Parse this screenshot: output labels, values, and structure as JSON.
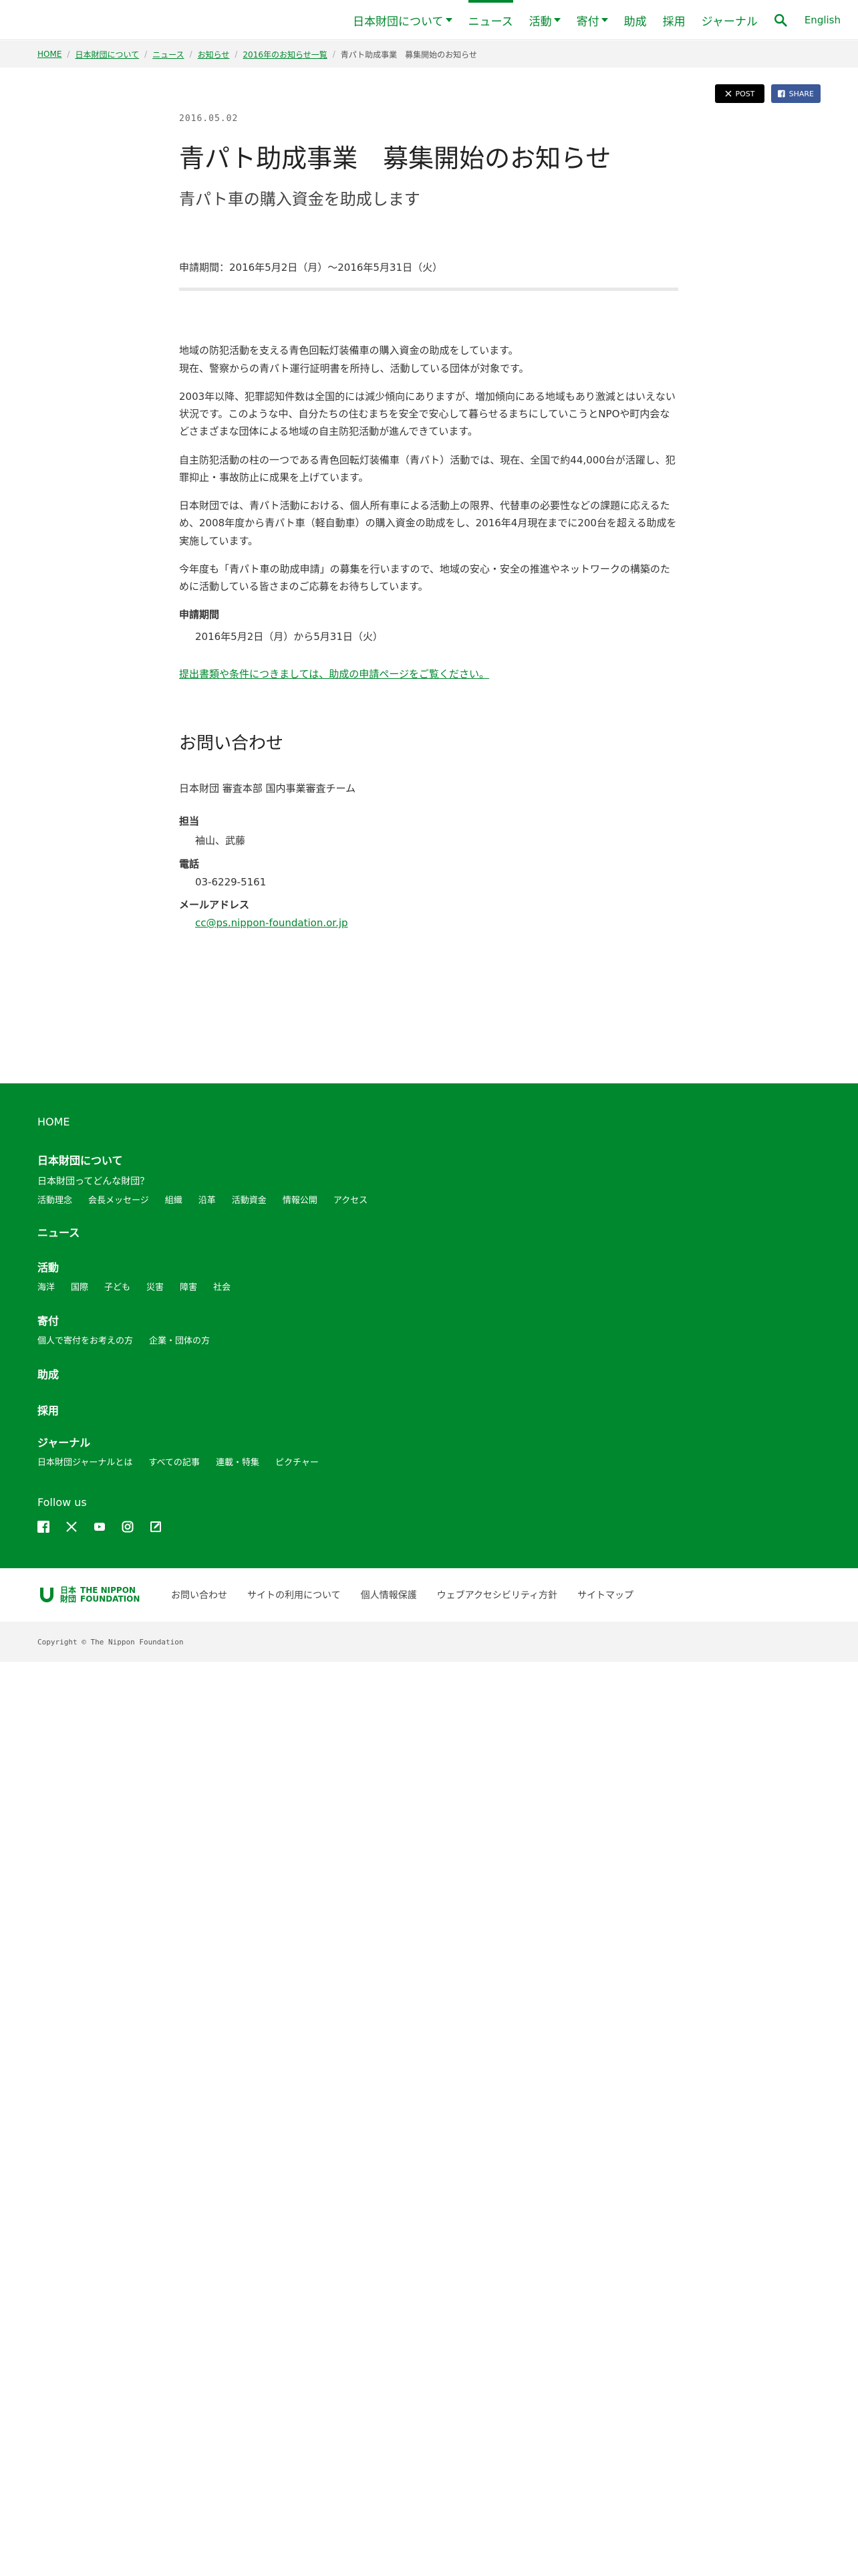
{
  "header": {
    "nav": [
      {
        "label": "日本財団について",
        "dropdown": true,
        "active": false
      },
      {
        "label": "ニュース",
        "dropdown": false,
        "active": true
      },
      {
        "label": "活動",
        "dropdown": true,
        "active": false
      },
      {
        "label": "寄付",
        "dropdown": true,
        "active": false
      },
      {
        "label": "助成",
        "dropdown": false,
        "active": false
      },
      {
        "label": "採用",
        "dropdown": false,
        "active": false
      },
      {
        "label": "ジャーナル",
        "dropdown": false,
        "active": false
      }
    ],
    "search_icon": "search-icon",
    "english_label": "English"
  },
  "breadcrumb": {
    "items": [
      "HOME",
      "日本財団について",
      "ニュース",
      "お知らせ",
      "2016年のお知らせ一覧"
    ],
    "current": "青パト助成事業　募集開始のお知らせ"
  },
  "share": {
    "x_label": "POST",
    "fb_label": "SHARE"
  },
  "article": {
    "date": "2016.05.02",
    "title": "青パト助成事業　募集開始のお知らせ",
    "subtitle": "青パト車の購入資金を助成します",
    "period": "申請期間：2016年5月2日（月）〜2016年5月31日（火）",
    "paragraphs": [
      "地域の防犯活動を支える青色回転灯装備車の購入資金の助成をしています。\n現在、警察からの青パト運行証明書を所持し、活動している団体が対象です。",
      "2003年以降、犯罪認知件数は全国的には減少傾向にありますが、増加傾向にある地域もあり激減とはいえない状況です。このような中、自分たちの住むまちを安全で安心して暮らせるまちにしていこうとNPOや町内会などさまざまな団体による地域の自主防犯活動が進んできています。",
      "自主防犯活動の柱の一つである青色回転灯装備車（青パト）活動では、現在、全国で約44,000台が活躍し、犯罪抑止・事故防止に成果を上げています。",
      "日本財団では、青パト活動における、個人所有車による活動上の限界、代替車の必要性などの課題に応えるため、2008年度から青パト車（軽自動車）の購入資金の助成をし、2016年4月現在までに200台を超える助成を実施しています。",
      "今年度も「青パト車の助成申請」の募集を行いますので、地域の安心・安全の推進やネットワークの構築のために活動している皆さまのご応募をお待ちしています。"
    ],
    "period_label": "申請期間",
    "period_value": "2016年5月2日（月）から5月31日（火）",
    "link_text": "提出書類や条件につきましては、助成の申請ページをご覧ください。"
  },
  "contact": {
    "heading": "お問い合わせ",
    "team": "日本財団 審査本部 国内事業審査チーム",
    "person_label": "担当",
    "person_value": "袖山、武藤",
    "phone_label": "電話",
    "phone_value": "03-6229-5161",
    "mail_label": "メールアドレス",
    "mail_value": "cc@ps.nippon-foundation.or.jp"
  },
  "footer": {
    "home": "HOME",
    "about": {
      "heading": "日本財団について",
      "sub": "日本財団ってどんな財団？",
      "links": [
        "活動理念",
        "会長メッセージ",
        "組織",
        "沿革",
        "活動資金",
        "情報公開",
        "アクセス"
      ]
    },
    "news": "ニュース",
    "activity": {
      "heading": "活動",
      "links": [
        "海洋",
        "国際",
        "子ども",
        "災害",
        "障害",
        "社会"
      ]
    },
    "donate": {
      "heading": "寄付",
      "links": [
        "個人で寄付をお考えの方",
        "企業・団体の方"
      ]
    },
    "grant": "助成",
    "recruit": "採用",
    "journal": {
      "heading": "ジャーナル",
      "links": [
        "日本財団ジャーナルとは",
        "すべての記事",
        "連載・特集",
        "ピクチャー"
      ]
    },
    "follow": "Follow us",
    "social": [
      "facebook-icon",
      "x-icon",
      "youtube-icon",
      "instagram-icon",
      "note-icon"
    ]
  },
  "footer2": {
    "logo_jp": "日本",
    "logo_jp2": "財団",
    "logo_en1": "THE NIPPON",
    "logo_en2": "FOUNDATION",
    "links": [
      "お問い合わせ",
      "サイトの利用について",
      "個人情報保護",
      "ウェブアクセシビリティ方針",
      "サイトマップ"
    ]
  },
  "copyright": "Copyright © The Nippon Foundation",
  "colors": {
    "brand_green": "#00882e"
  }
}
